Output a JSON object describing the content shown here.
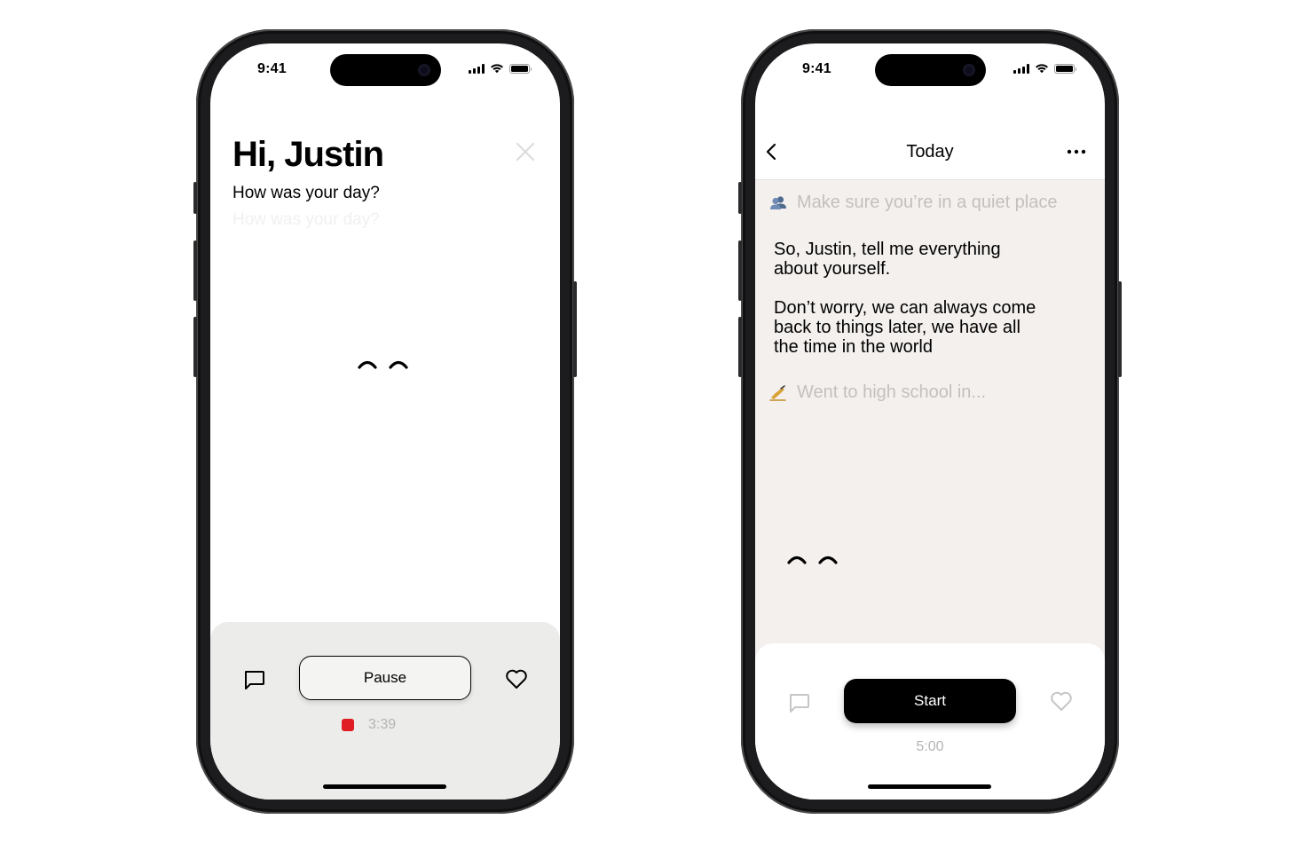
{
  "left_phone": {
    "status": {
      "time": "9:41"
    },
    "greeting": "Hi, Justin",
    "question": "How was your day?",
    "question_ghost": "How was your day?",
    "controls": {
      "pause_label": "Pause",
      "recording_time": "3:39"
    },
    "colors": {
      "panel": "#ececeb",
      "record": "#e01c24"
    }
  },
  "right_phone": {
    "status": {
      "time": "9:41"
    },
    "nav": {
      "title": "Today"
    },
    "tip": "Make sure you’re in a quiet place",
    "message_1": "So, Justin, tell me everything about yourself.",
    "message_2": "Don’t worry, we can always come back to things later, we have all the time in the world",
    "prompt_placeholder": "Went to high school in...",
    "controls": {
      "start_label": "Start",
      "timer": "5:00"
    },
    "colors": {
      "content_bg": "#f3f0ee"
    }
  },
  "icons": [
    "close-icon",
    "chat-bubble-icon",
    "heart-icon",
    "back-chevron-icon",
    "more-icon",
    "people-emoji-icon",
    "writing-hand-emoji-icon",
    "signal-icon",
    "wifi-icon",
    "battery-icon"
  ]
}
